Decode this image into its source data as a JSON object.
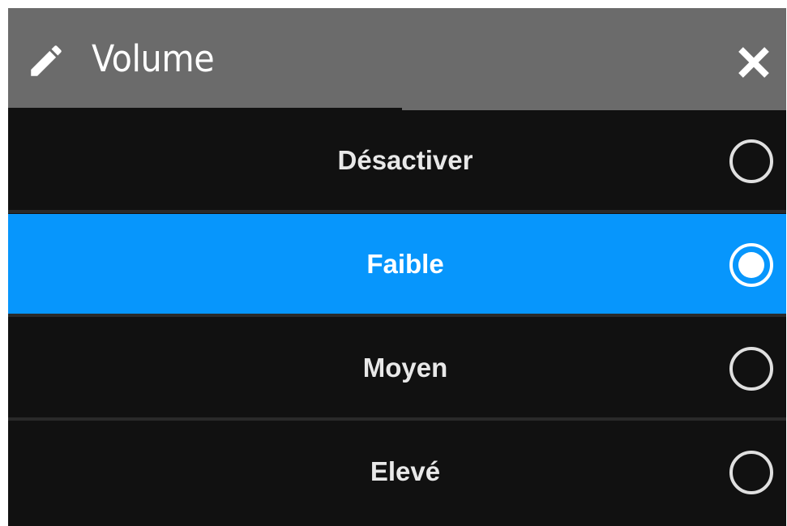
{
  "dialog": {
    "title": "Volume",
    "options": [
      {
        "label": "Désactiver",
        "selected": false
      },
      {
        "label": "Faible",
        "selected": true
      },
      {
        "label": "Moyen",
        "selected": false
      },
      {
        "label": "Elevé",
        "selected": false
      }
    ]
  },
  "icons": {
    "title_icon": "pencil-icon",
    "close_icon": "close-icon",
    "radio_unchecked": "radio-unchecked-icon",
    "radio_checked": "radio-checked-icon"
  },
  "colors": {
    "header_bg": "#6b6b6b",
    "list_bg": "#111111",
    "selected_bg": "#0796fc",
    "text": "#e8e8e8"
  }
}
